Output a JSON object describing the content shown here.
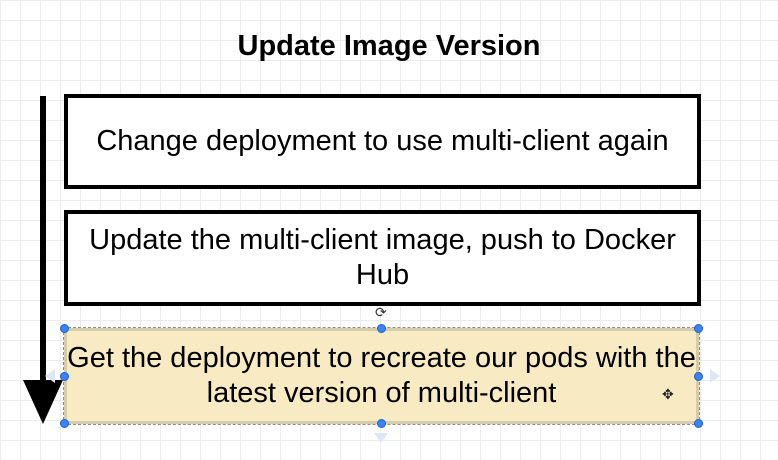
{
  "diagram": {
    "title": "Update Image Version",
    "steps": [
      {
        "text": "Change deployment to use multi-client again",
        "selected": false
      },
      {
        "text": "Update the multi-client image, push to Docker Hub",
        "selected": false
      },
      {
        "text": "Get the deployment to recreate our pods with the latest version of multi-client",
        "selected": true
      }
    ],
    "arrow_direction": "down"
  },
  "colors": {
    "background": "#ffffff",
    "grid": "#ececec",
    "box_border": "#000000",
    "selected_fill": "#f8eac2",
    "selection_handle": "#3b82f6"
  },
  "icons": {
    "rotate": "rotate-handle-icon",
    "move": "move-cursor-icon"
  }
}
